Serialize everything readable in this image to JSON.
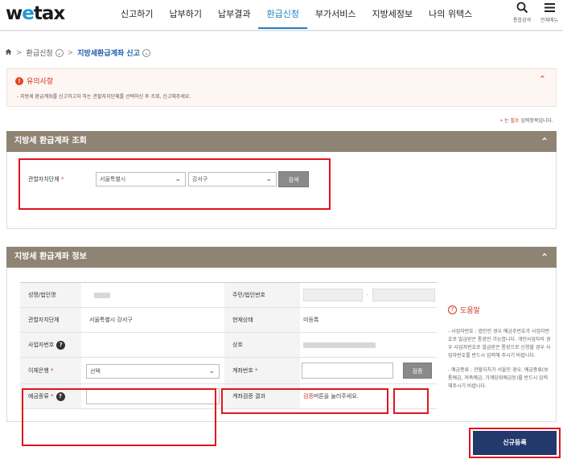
{
  "header": {
    "logo": "wetax",
    "nav": [
      "신고하기",
      "납부하기",
      "납부결과",
      "환급신청",
      "부가서비스",
      "지방세정보",
      "나의 위택스"
    ],
    "active_index": 3,
    "search_caption": "통합검색",
    "menu_caption": "전체메뉴"
  },
  "breadcrumb": {
    "home_icon": "home-icon",
    "level1": "환급신청",
    "level2": "지방세환급계좌 신고"
  },
  "notice": {
    "title": "유의사항",
    "text": "- 지방세 환급계좌를 신고하고자 하는 관할자치단체를 선택하신 후 조회, 신고해주세요."
  },
  "required_note": {
    "star": "•",
    "prefix": "는 ",
    "emph": "필수",
    "suffix": " 입력항목입니다."
  },
  "lookup": {
    "title": "지방세 환급계좌 조회",
    "label": "관할자치단체",
    "sido": "서울특별시",
    "sigungu": "강서구",
    "search_button": "검색"
  },
  "info": {
    "title": "지방세 환급계좌 정보",
    "labels": {
      "name": "성명/법인명",
      "resident_no": "주민/법인번호",
      "jurisdiction": "관할자치단체",
      "status": "현재상태",
      "biz_no": "사업자번호",
      "trade_name": "상호",
      "bank": "이체은행",
      "account_no": "계좌번호",
      "deposit_type": "예금종류",
      "verify_result": "계좌검증 결과"
    },
    "values": {
      "jurisdiction": "서울특별시 강서구",
      "status": "미등록",
      "bank_selected": "선택",
      "verify_emph": "검증",
      "verify_rest": "버튼을 눌러주세요."
    },
    "verify_button": "검증"
  },
  "help": {
    "title": "도움말",
    "p1": "- 사업자번호 : 법인인 경우 예금주번호가 사업자번호로 발급받은 통장만 가능합니다. 개인사업자의 경우 사업자번호로 발급받은 통장으로 신청할 경우 사업자번호를 반드시 입력해 주시기 바랍니다.",
    "p2": "- 예금종류 : 관할자치가 서울인 경우, 예금종류(보통예금, 저축예금, 가계당좌예금등)를 반드시 입력해주시기 바랍니다."
  },
  "submit_button": "신규등록",
  "colors": {
    "section_header": "#8f8474",
    "primary_button": "#23386b",
    "highlight_box": "#e0141e",
    "accent_red": "#d2341c",
    "nav_active": "#1e7fc2"
  }
}
